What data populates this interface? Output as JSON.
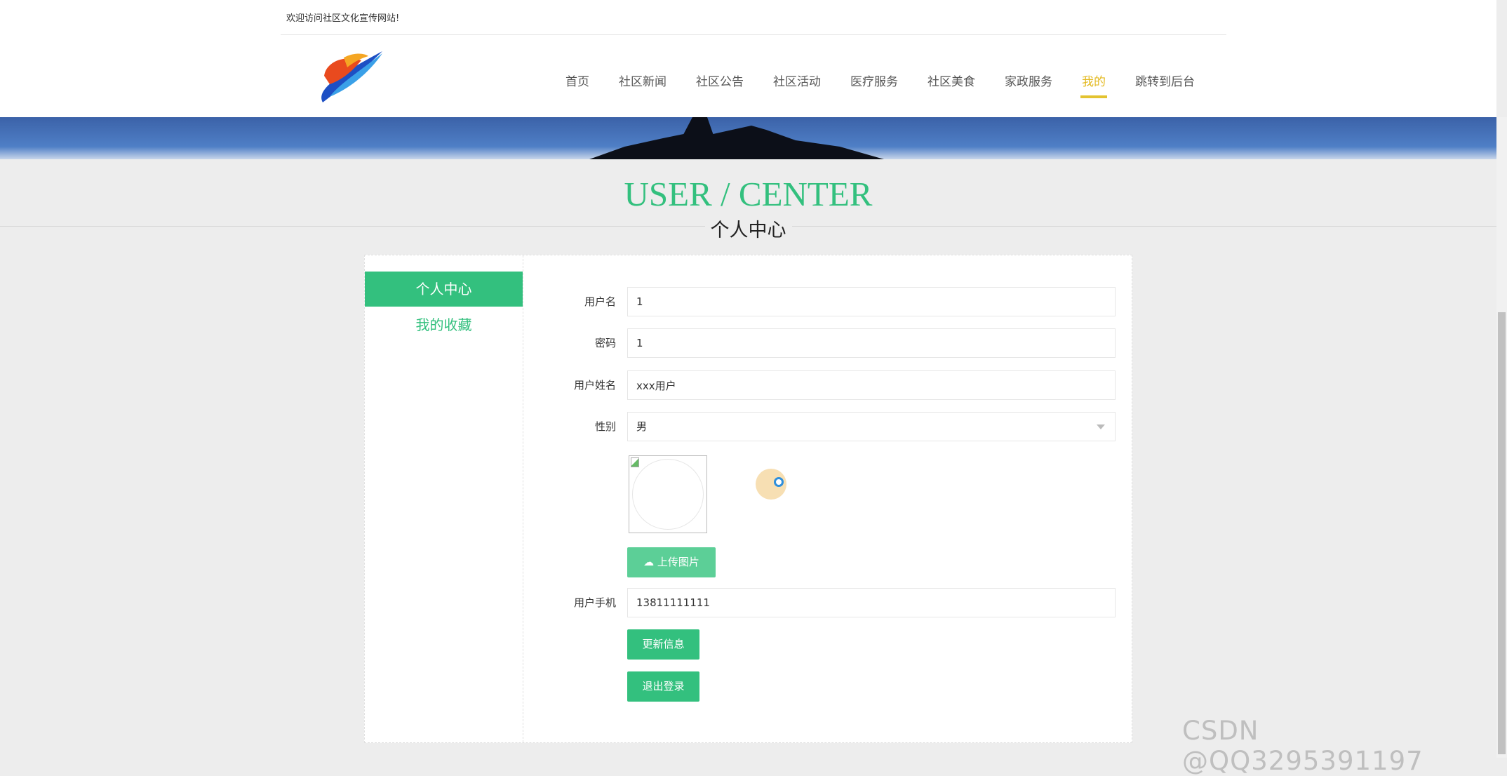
{
  "header": {
    "welcome": "欢迎访问社区文化宣传网站!"
  },
  "nav": [
    {
      "label": "首页"
    },
    {
      "label": "社区新闻"
    },
    {
      "label": "社区公告"
    },
    {
      "label": "社区活动"
    },
    {
      "label": "医疗服务"
    },
    {
      "label": "社区美食"
    },
    {
      "label": "家政服务"
    },
    {
      "label": "我的",
      "active": true
    },
    {
      "label": "跳转到后台"
    }
  ],
  "page": {
    "title_en": "USER / CENTER",
    "title_cn": "个人中心"
  },
  "sidebar": {
    "items": [
      {
        "label": "个人中心",
        "active": true
      },
      {
        "label": "我的收藏"
      }
    ]
  },
  "form": {
    "username": {
      "label": "用户名",
      "value": "1"
    },
    "password": {
      "label": "密码",
      "value": "1"
    },
    "name": {
      "label": "用户姓名",
      "value": "xxx用户"
    },
    "gender": {
      "label": "性别",
      "value": "男"
    },
    "upload_label": "上传图片",
    "phone": {
      "label": "用户手机",
      "value": "13811111111"
    },
    "update_label": "更新信息",
    "logout_label": "退出登录"
  },
  "colors": {
    "accent": "#33c07e",
    "nav_active": "#e3b920"
  },
  "watermark": "CSDN @QQ3295391197"
}
